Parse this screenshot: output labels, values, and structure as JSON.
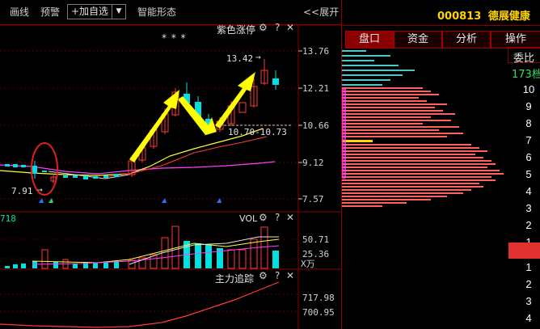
{
  "toolbar": {
    "draw_line": "画线",
    "alert": "预警",
    "add_watchlist": "+加自选",
    "dropdown_glyph": "▼",
    "smart_pattern": "智能形态",
    "expand": "<<展开"
  },
  "stock": {
    "code": "000813",
    "name": "德展健康"
  },
  "tabs": [
    "盘口",
    "资金",
    "分析",
    "操作"
  ],
  "weibi_label": "委比",
  "lot_label": "173档",
  "ask_levels": [
    "10",
    "9",
    "8",
    "7",
    "6",
    "5",
    "4",
    "3",
    "2",
    "1"
  ],
  "bid_levels": [
    "1",
    "2",
    "3",
    "4"
  ],
  "main_chart": {
    "indicator_name": "紫色涨停",
    "stars": "* * *",
    "y_ticks": [
      "13.76",
      "12.21",
      "10.66",
      "9.12",
      "7.57"
    ],
    "annotations": {
      "high": "13.42",
      "low": "7.91",
      "range": "10.70-10.73"
    }
  },
  "vol_chart": {
    "name": "VOL",
    "prefix_value": "718",
    "y_ticks": [
      "50.71",
      "25.36"
    ],
    "unit": "X万"
  },
  "main_force": {
    "name": "主力追踪",
    "y_ticks": [
      "717.98",
      "700.95"
    ]
  },
  "icons": {
    "gear": "⚙",
    "help": "?",
    "close": "✕"
  },
  "colors": {
    "up": "#ff3a3a",
    "down": "#00e0e0",
    "accent": "#ffd400",
    "grid_border": "#8a0000",
    "ma_magenta": "#ff40ff",
    "ma_yellow": "#ffff40"
  }
}
